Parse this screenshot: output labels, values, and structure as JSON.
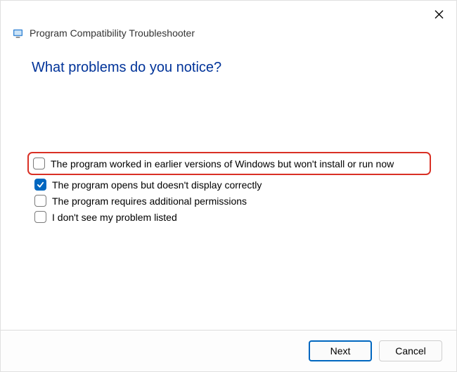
{
  "dialog": {
    "title": "Program Compatibility Troubleshooter",
    "question": "What problems do you notice?"
  },
  "options": [
    {
      "label": "The program worked in earlier versions of Windows but won't install or run now",
      "checked": false,
      "highlighted": true
    },
    {
      "label": "The program opens but doesn't display correctly",
      "checked": true,
      "highlighted": false
    },
    {
      "label": "The program requires additional permissions",
      "checked": false,
      "highlighted": false
    },
    {
      "label": "I don't see my problem listed",
      "checked": false,
      "highlighted": false
    }
  ],
  "buttons": {
    "next": "Next",
    "cancel": "Cancel"
  }
}
